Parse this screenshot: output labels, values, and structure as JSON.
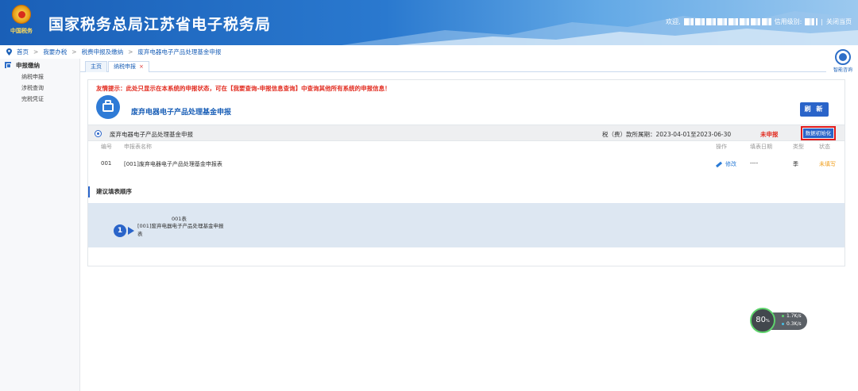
{
  "header": {
    "site_title": "国家税务总局江苏省电子税务局",
    "emblem_text": "中国税务",
    "welcome": "欢迎,",
    "credit_label": "信用级别:",
    "separator": "|",
    "close_label": "关闭当页"
  },
  "breadcrumb": {
    "items": [
      "首页",
      "我要办税",
      "税费申报及缴纳",
      "废弃电器电子产品处理基金申报"
    ],
    "sep": ">"
  },
  "sidebar": {
    "section": "申报缴纳",
    "items": [
      "纳税申报",
      "涉税查询",
      "完税凭证"
    ]
  },
  "tabs": {
    "home": "主页",
    "current": "纳税申报",
    "close": "×"
  },
  "assistant": {
    "label": "智能咨询"
  },
  "panel": {
    "notice": "友情提示：此处只显示在本系统的申报状态，可在【我要查询-申报信息查询】中查询其他所有系统的申报信息！",
    "form_title": "废弃电器电子产品处理基金申报",
    "refresh_label": "刷 新",
    "section_name": "废弃电器电子产品处理基金申报",
    "period": "税（费）款所属期：2023-04-01至2023-06-30",
    "status": "未申报",
    "init_label": "数据初始化",
    "columns": {
      "no": "编号",
      "name": "申报表名称",
      "op": "操作",
      "date": "填表日期",
      "type": "类型",
      "stat": "状态"
    },
    "rows": [
      {
        "no": "001",
        "name": "[001]废弃电器电子产品处理基金申报表",
        "op": "修改",
        "date": "----",
        "type": "季",
        "stat": "未填写"
      }
    ],
    "order_title": "建议填表顺序",
    "step": {
      "num": "1",
      "code": "001表",
      "name": "[001]废弃电器电子产品处理基金申报表"
    }
  },
  "speed_widget": {
    "percent": "80",
    "unit": "%",
    "up": "1.7",
    "down": "0.3",
    "rate_unit": "K/s",
    "colors": {
      "ring": "#5ed36c",
      "up": "#5ed36c",
      "down": "#47c0e6"
    }
  },
  "colors": {
    "brand": "#1a5fb7",
    "accent": "#2a64c9",
    "alert": "#e22b1f",
    "warn": "#f0a020"
  }
}
